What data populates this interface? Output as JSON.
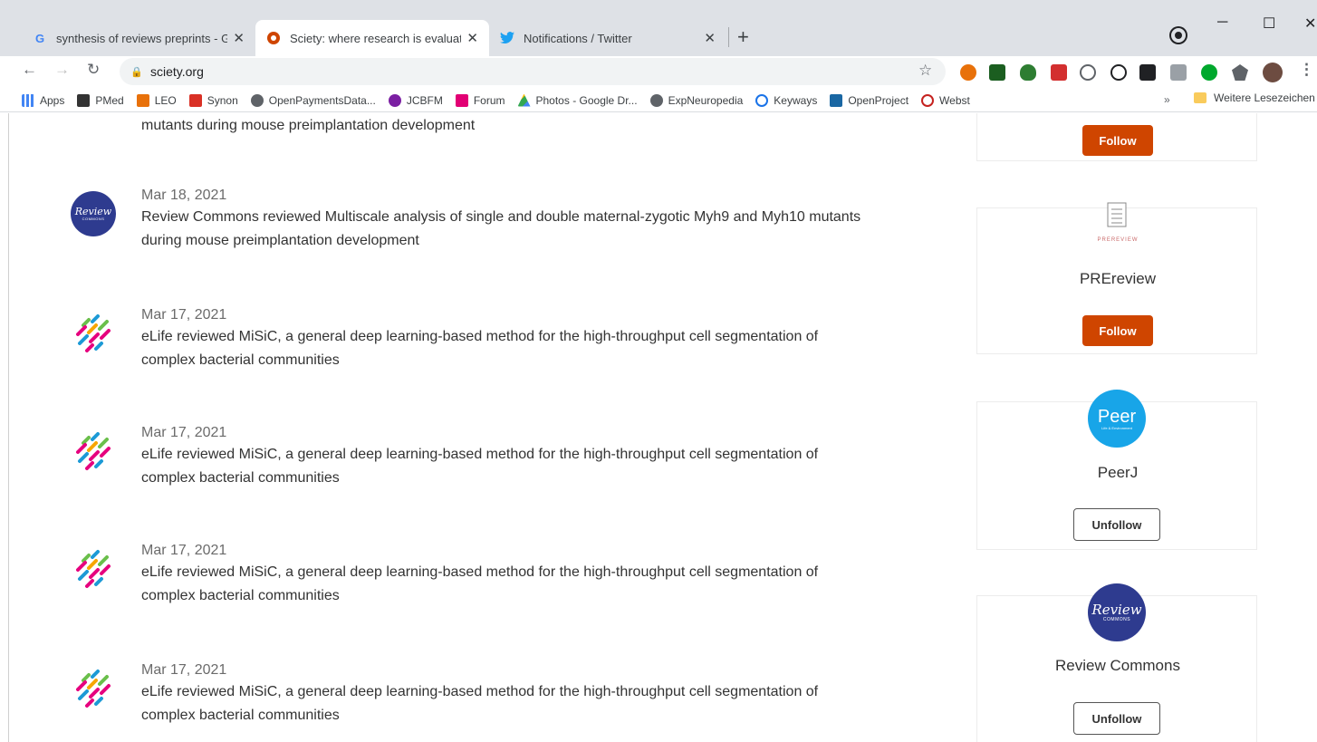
{
  "browser": {
    "tabs": [
      {
        "title": "synthesis of reviews preprints - G",
        "favicon": "google-icon"
      },
      {
        "title": "Sciety: where research is evaluat",
        "favicon": "sciety-icon"
      },
      {
        "title": "Notifications / Twitter",
        "favicon": "twitter-icon"
      }
    ],
    "new_tab": "+",
    "address": "sciety.org",
    "bookmarks": [
      {
        "label": "Apps",
        "color": "#4285f4"
      },
      {
        "label": "PMed",
        "color": "#333333"
      },
      {
        "label": "LEO",
        "color": "#e8710a"
      },
      {
        "label": "Synon",
        "color": "#d93025"
      },
      {
        "label": "OpenPaymentsData...",
        "color": "#5f6368"
      },
      {
        "label": "JCBFM",
        "color": "#7b1fa2"
      },
      {
        "label": "Forum",
        "color": "#e20074"
      },
      {
        "label": "Photos - Google Dr...",
        "color": "#fbbc04"
      },
      {
        "label": "ExpNeuropedia",
        "color": "#5f6368"
      },
      {
        "label": "Keyways",
        "color": "#1a73e8"
      },
      {
        "label": "OpenProject",
        "color": "#1a67a3"
      },
      {
        "label": "Webst",
        "color": "#c5221f"
      }
    ],
    "bookmarks_more": "»",
    "other_bookmarks": "Weitere Lesezeichen"
  },
  "feed": {
    "cut_off_text": "mutants during mouse preimplantation development",
    "items": [
      {
        "date": "Mar 18, 2021",
        "text": "Review Commons reviewed Multiscale analysis of single and double maternal-zygotic Myh9 and Myh10 mutants during mouse preimplantation development",
        "avatar": "review-commons"
      },
      {
        "date": "Mar 17, 2021",
        "text": "eLife reviewed MiSiC, a general deep learning-based method for the high-throughput cell segmentation of complex bacterial communities",
        "avatar": "elife"
      },
      {
        "date": "Mar 17, 2021",
        "text": "eLife reviewed MiSiC, a general deep learning-based method for the high-throughput cell segmentation of complex bacterial communities",
        "avatar": "elife"
      },
      {
        "date": "Mar 17, 2021",
        "text": "eLife reviewed MiSiC, a general deep learning-based method for the high-throughput cell segmentation of complex bacterial communities",
        "avatar": "elife"
      },
      {
        "date": "Mar 17, 2021",
        "text": "eLife reviewed MiSiC, a general deep learning-based method for the high-throughput cell segmentation of complex bacterial communities",
        "avatar": "elife"
      }
    ],
    "review_commons_avatar_text": {
      "line1": "Review",
      "line2": "COMMONS"
    }
  },
  "sidebar": {
    "cards": [
      {
        "name": "",
        "button": "Follow",
        "following": false
      },
      {
        "name": "PREreview",
        "button": "Follow",
        "following": false,
        "logo_text": "PREREVIEW"
      },
      {
        "name": "PeerJ",
        "button": "Unfollow",
        "following": true,
        "logo_text": "Peer",
        "logo_subtext": "Life & Environment"
      },
      {
        "name": "Review Commons",
        "button": "Unfollow",
        "following": true,
        "logo_text": "Review",
        "logo_subtext": "COMMONS"
      }
    ]
  },
  "colors": {
    "follow_button": "#cf4500",
    "review_commons": "#2e3b8f",
    "peerj": "#18a5e8"
  }
}
